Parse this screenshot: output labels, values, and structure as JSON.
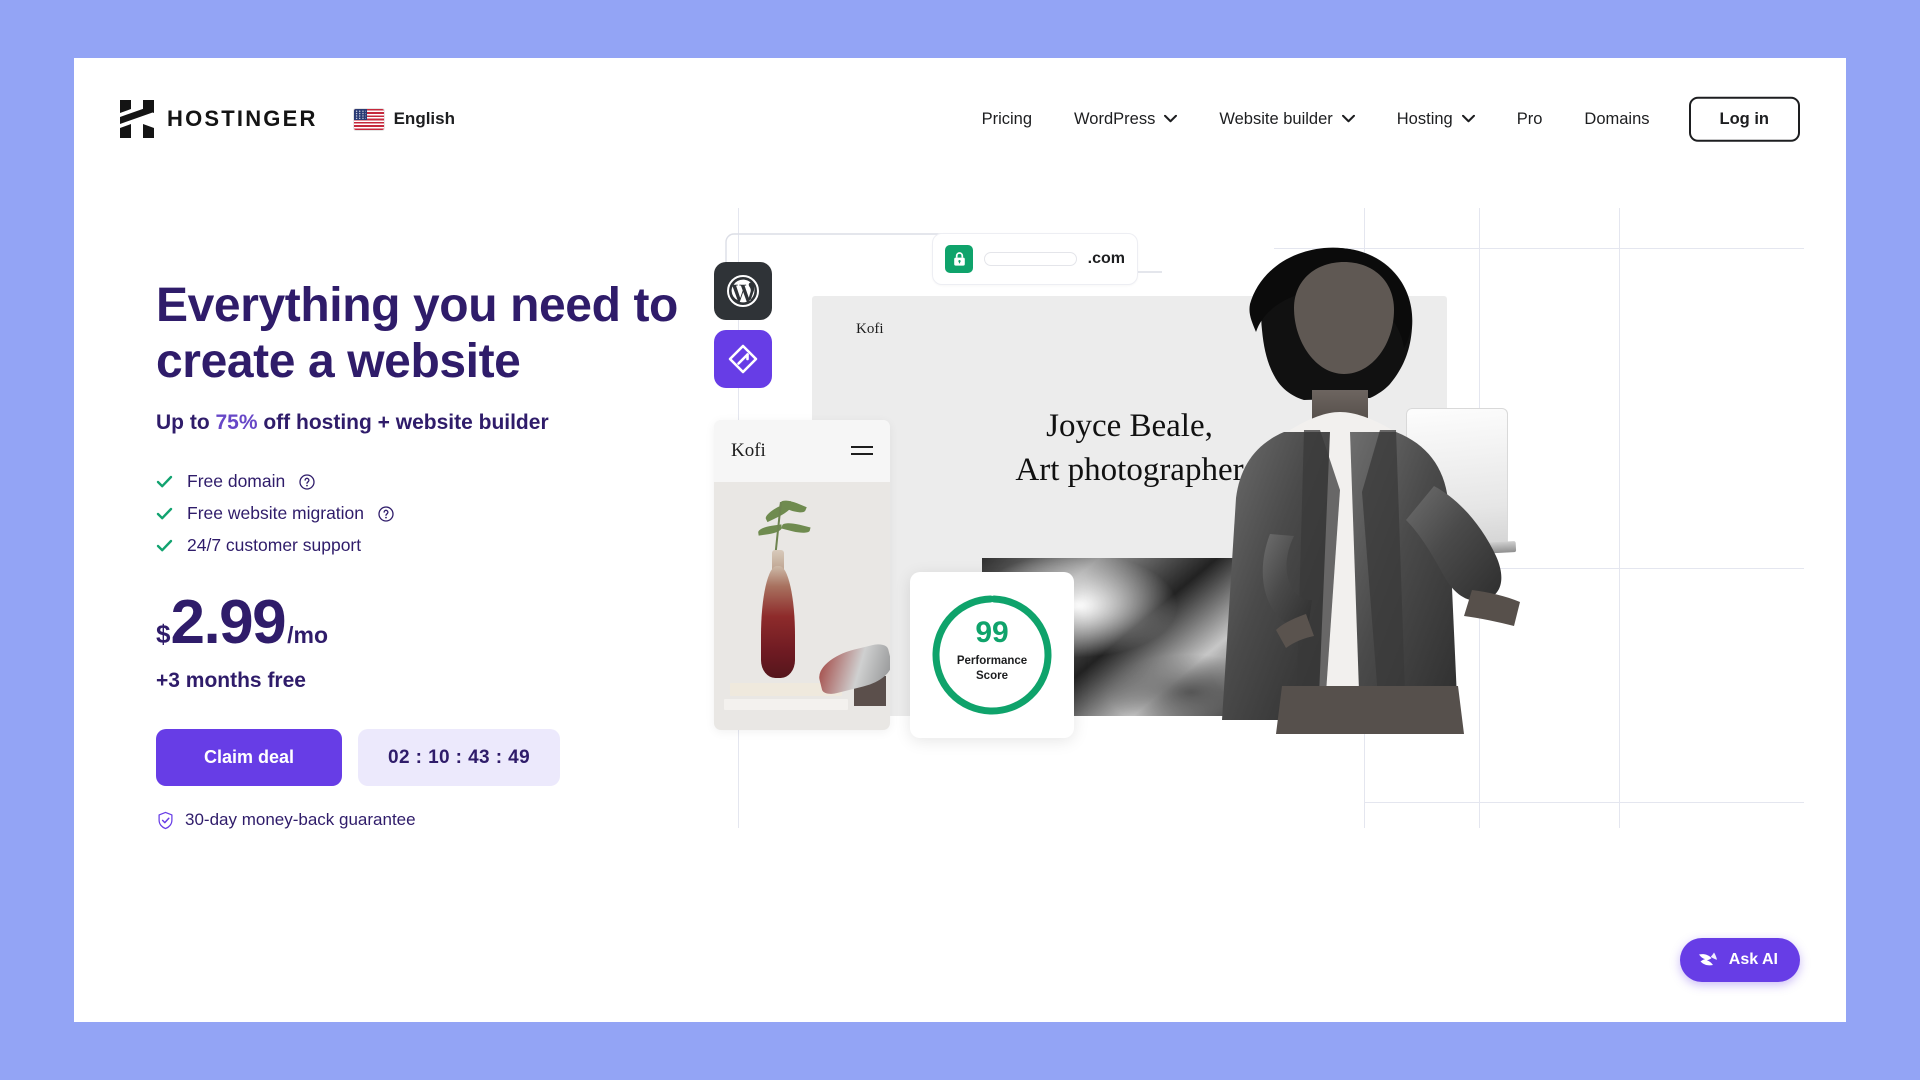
{
  "brand": {
    "name": "HOSTINGER",
    "logo_icon": "hostinger-logo-icon"
  },
  "language": {
    "label": "English",
    "flag_icon": "us-flag-icon"
  },
  "nav": {
    "items": [
      {
        "label": "Pricing",
        "has_dropdown": false
      },
      {
        "label": "WordPress",
        "has_dropdown": true
      },
      {
        "label": "Website builder",
        "has_dropdown": true
      },
      {
        "label": "Hosting",
        "has_dropdown": true
      },
      {
        "label": "Pro",
        "has_dropdown": false
      },
      {
        "label": "Domains",
        "has_dropdown": false
      }
    ],
    "login_label": "Log in"
  },
  "hero": {
    "headline_line1": "Everything you need to",
    "headline_line2": "create a website",
    "subhead_prefix": "Up to ",
    "subhead_percent": "75%",
    "subhead_suffix": " off hosting + website builder",
    "features": [
      {
        "label": "Free domain",
        "has_help": true
      },
      {
        "label": "Free website migration",
        "has_help": true
      },
      {
        "label": "24/7 customer support",
        "has_help": false
      }
    ],
    "price": {
      "currency": "$",
      "amount": "2.99",
      "period": "/mo",
      "bonus": "+3 months free"
    },
    "cta_label": "Claim deal",
    "timer": "02 : 10 : 43 : 49",
    "guarantee": "30-day money-back guarantee",
    "guarantee_icon": "shield-check-icon"
  },
  "artwork": {
    "domain_tld": ".com",
    "lock_icon": "lock-icon",
    "wordpress_icon": "wordpress-icon",
    "builder_icon": "hostinger-builder-icon",
    "desktop_site": {
      "brand": "Kofi",
      "title_line1": "Joyce Beale,",
      "title_line2": "Art photographer"
    },
    "mobile_site": {
      "brand": "Kofi",
      "menu_icon": "hamburger-menu-icon"
    },
    "performance": {
      "score": "99",
      "label_line1": "Performance",
      "label_line2": "Score"
    }
  },
  "assistant": {
    "label": "Ask AI",
    "icon": "ai-sparkle-icon"
  },
  "colors": {
    "page_background": "#93a4f5",
    "brand_purple": "#673de6",
    "deep_purple": "#2f1c6a",
    "accent_green": "#0fa36b",
    "timer_background": "#ece9fc"
  }
}
